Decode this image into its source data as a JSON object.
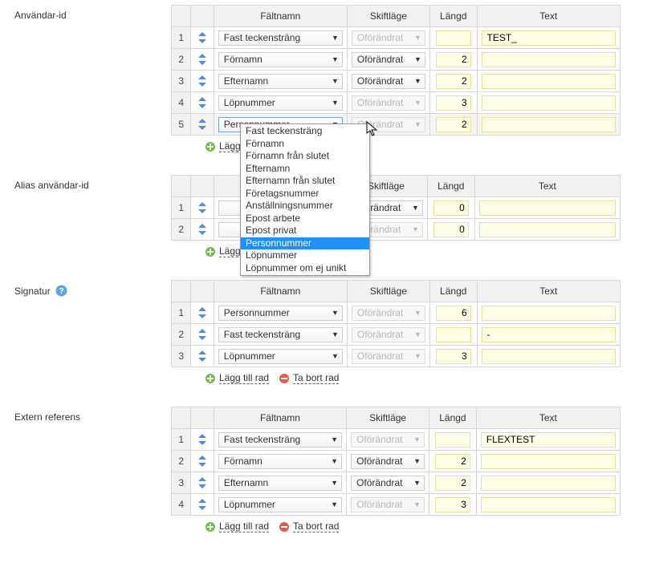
{
  "headers": {
    "faltnamn": "Fältnamn",
    "skiftlage": "Skiftläge",
    "langd": "Längd",
    "text": "Text"
  },
  "caseValue": "Oförändrat",
  "actions": {
    "add": "Lägg till rad",
    "addShort": "Lägg til",
    "remove": "Ta bort rad"
  },
  "dropdown": {
    "options": [
      "Fast teckensträng",
      "Förnamn",
      "Förnamn från slutet",
      "Efternamn",
      "Efternamn från slutet",
      "Företagsnummer",
      "Anställningsnummer",
      "Epost arbete",
      "Epost privat",
      "Personnummer",
      "Löpnummer",
      "Löpnummer om ej unikt"
    ],
    "highlightIndex": 9
  },
  "sections": [
    {
      "key": "user_id",
      "label": "Användar-id",
      "help": false,
      "hasDropdown": true,
      "rows": [
        {
          "num": "1",
          "field": "Fast teckensträng",
          "case": true,
          "caseDisabled": true,
          "len": "",
          "text": "TEST_",
          "active": false
        },
        {
          "num": "2",
          "field": "Förnamn",
          "case": true,
          "caseDisabled": false,
          "len": "2",
          "text": "",
          "active": false
        },
        {
          "num": "3",
          "field": "Efternamn",
          "case": true,
          "caseDisabled": false,
          "len": "2",
          "text": "",
          "active": false
        },
        {
          "num": "4",
          "field": "Löpnummer",
          "case": true,
          "caseDisabled": true,
          "len": "3",
          "text": "",
          "active": false
        },
        {
          "num": "5",
          "field": "Personnummer",
          "case": true,
          "caseDisabled": true,
          "len": "2",
          "text": "",
          "active": true
        }
      ]
    },
    {
      "key": "alias",
      "label": "Alias användar-id",
      "help": false,
      "rows": [
        {
          "num": "1",
          "field": "",
          "case": true,
          "caseDisabled": false,
          "len": "0",
          "text": "",
          "active": false
        },
        {
          "num": "2",
          "field": "",
          "case": true,
          "caseDisabled": true,
          "len": "0",
          "text": "",
          "active": false
        }
      ]
    },
    {
      "key": "signatur",
      "label": "Signatur",
      "help": true,
      "rows": [
        {
          "num": "1",
          "field": "Personnummer",
          "case": true,
          "caseDisabled": true,
          "len": "6",
          "text": "",
          "active": false
        },
        {
          "num": "2",
          "field": "Fast teckensträng",
          "case": true,
          "caseDisabled": true,
          "len": "",
          "text": "-",
          "active": false
        },
        {
          "num": "3",
          "field": "Löpnummer",
          "case": true,
          "caseDisabled": true,
          "len": "3",
          "text": "",
          "active": false
        }
      ]
    },
    {
      "key": "extern",
      "label": "Extern referens",
      "help": false,
      "rows": [
        {
          "num": "1",
          "field": "Fast teckensträng",
          "case": true,
          "caseDisabled": true,
          "len": "",
          "text": "FLEXTEST",
          "active": false
        },
        {
          "num": "2",
          "field": "Förnamn",
          "case": true,
          "caseDisabled": false,
          "len": "2",
          "text": "",
          "active": false
        },
        {
          "num": "3",
          "field": "Efternamn",
          "case": true,
          "caseDisabled": false,
          "len": "2",
          "text": "",
          "active": false
        },
        {
          "num": "4",
          "field": "Löpnummer",
          "case": true,
          "caseDisabled": true,
          "len": "3",
          "text": "",
          "active": false
        }
      ]
    }
  ]
}
